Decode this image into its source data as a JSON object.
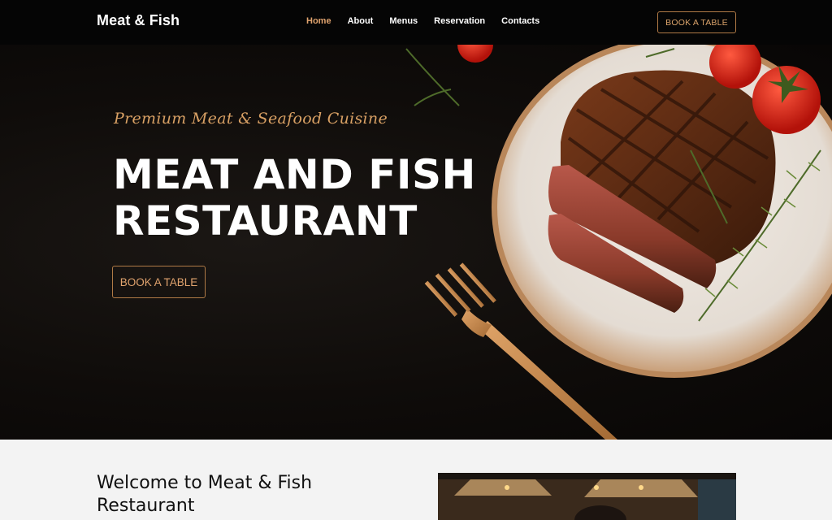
{
  "header": {
    "logo": "Meat & Fish",
    "nav": [
      {
        "label": "Home",
        "active": true
      },
      {
        "label": "About",
        "active": false
      },
      {
        "label": "Menus",
        "active": false
      },
      {
        "label": "Reservation",
        "active": false
      },
      {
        "label": "Contacts",
        "active": false
      }
    ],
    "book_label": "BOOK A TABLE"
  },
  "hero": {
    "tagline": "Premium Meat & Seafood Cuisine",
    "title": "MEAT AND FISH RESTAURANT",
    "book_label": "BOOK A TABLE"
  },
  "welcome": {
    "title": "Welcome to Meat & Fish Restaurant"
  },
  "colors": {
    "accent": "#e0a36e",
    "background_dark": "#050505",
    "section_light": "#f3f3f3"
  }
}
